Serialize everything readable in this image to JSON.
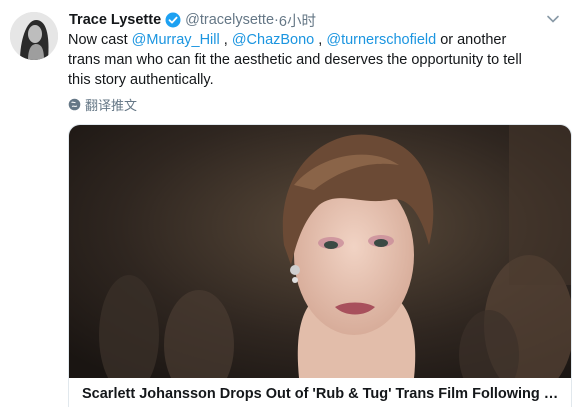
{
  "tweet": {
    "display_name": "Trace Lysette",
    "handle": "@tracelysette",
    "separator": "·",
    "time": "6小时",
    "text_parts": {
      "prefix": "Now cast ",
      "mention1": "@Murray_Hill",
      "sep1": " , ",
      "mention2": "@ChazBono",
      "sep2": " , ",
      "mention3": "@turnerschofield",
      "suffix": " or another trans man who can fit the aesthetic and deserves the opportunity to tell this story authentically."
    },
    "translate_label": "翻译推文"
  },
  "card": {
    "title": "Scarlett Johansson Drops Out of 'Rub & Tug' Trans Film Following Backlash"
  },
  "colors": {
    "link": "#1b95e0",
    "verified": "#1da1f2",
    "muted": "#657786",
    "text": "#14171a"
  },
  "icons": {
    "verified": "verified-badge-icon",
    "caret": "chevron-down-icon",
    "translate": "globe-icon"
  }
}
